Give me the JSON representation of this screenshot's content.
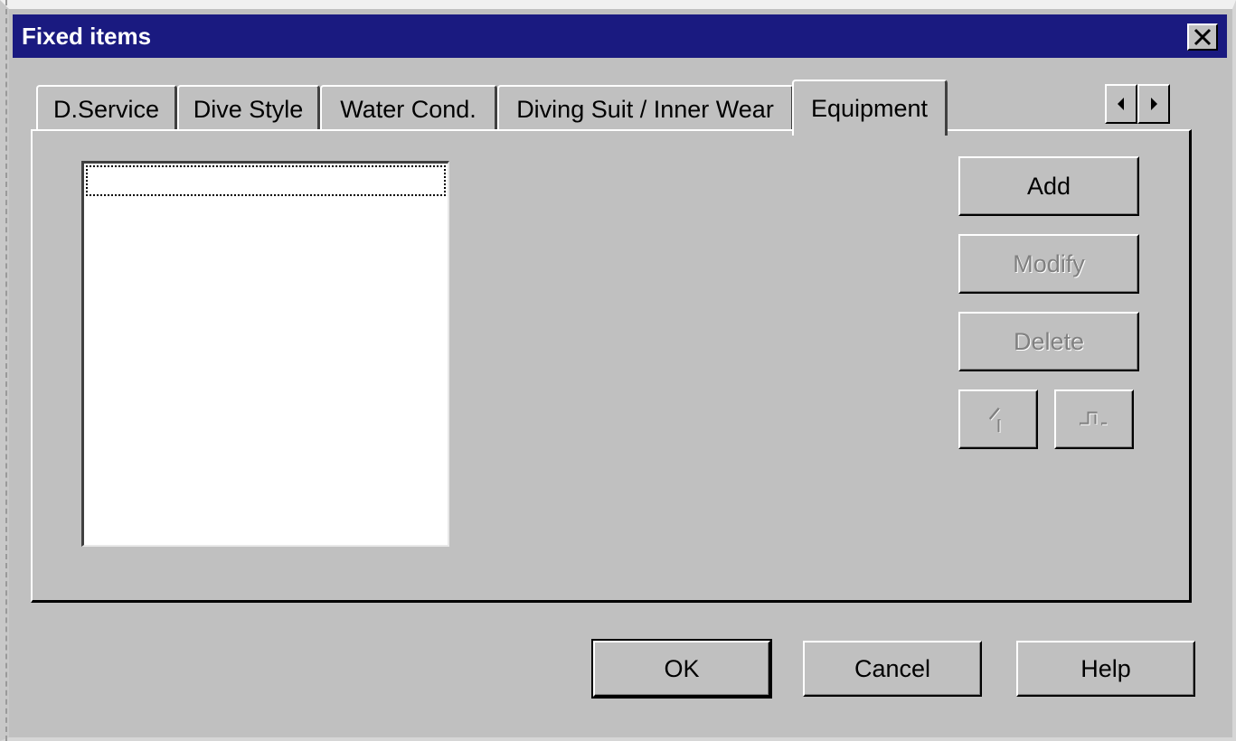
{
  "window": {
    "title": "Fixed items",
    "close_glyph": "✕"
  },
  "tabs": [
    {
      "label": "D.Service",
      "active": false
    },
    {
      "label": "Dive Style",
      "active": false
    },
    {
      "label": "Water Cond.",
      "active": false
    },
    {
      "label": "Diving Suit / Inner Wear",
      "active": false
    },
    {
      "label": "Equipment",
      "active": true
    }
  ],
  "tab_scroll": {
    "left_icon": "triangle-left-icon",
    "right_icon": "triangle-right-icon"
  },
  "list": {
    "items": []
  },
  "side_buttons": {
    "add": "Add",
    "modify": "Modify",
    "delete": "Delete",
    "move_up_icon": "move-up-icon",
    "move_down_icon": "move-down-icon"
  },
  "footer_buttons": {
    "ok": "OK",
    "cancel": "Cancel",
    "help": "Help"
  },
  "colors": {
    "titlebar": "#1a1a80",
    "face": "#c0c0c0",
    "disabled_text": "#808080"
  }
}
